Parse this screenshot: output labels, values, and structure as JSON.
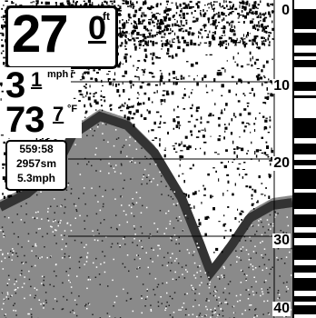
{
  "depth": {
    "whole": "27",
    "decimal": "0",
    "unit": "ft"
  },
  "speed": {
    "whole": "3",
    "decimal": "1",
    "unit": "mph"
  },
  "temperature": {
    "whole": "73",
    "decimal": "7",
    "unit": "°F"
  },
  "info": {
    "timer": "559:58",
    "distance": "2957sm",
    "avg_speed": "5.3mph"
  },
  "depth_scale": {
    "labels": [
      "0",
      "10",
      "20",
      "30",
      "40"
    ],
    "max_depth_ft": 40
  },
  "colors": {
    "background": "#ffffff",
    "foreground": "#000000",
    "bottom_fill": "#8a8a8a"
  }
}
